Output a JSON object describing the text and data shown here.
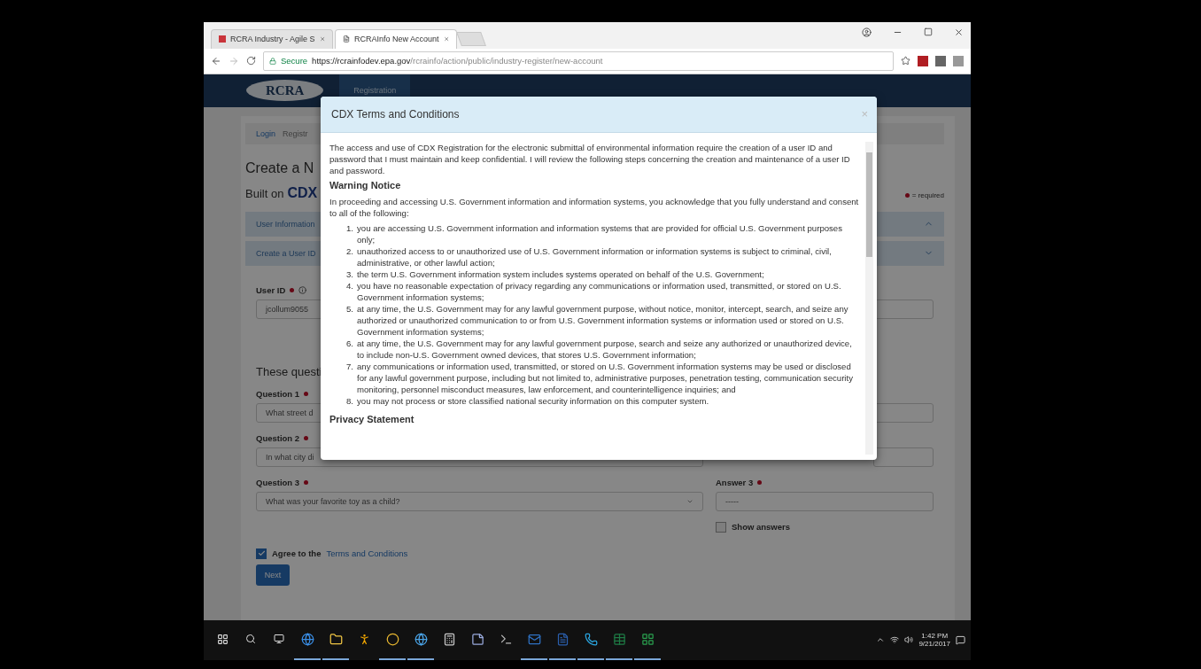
{
  "browser": {
    "tabs": [
      {
        "title": "RCRA Industry - Agile S",
        "selected": false,
        "kind": "site"
      },
      {
        "title": "RCRAInfo New Account",
        "selected": true,
        "kind": "page"
      }
    ],
    "security": "Secure",
    "url_host": "https://rcrainfodev.epa.gov",
    "url_path": "/rcrainfo/action/public/industry-register/new-account"
  },
  "site": {
    "logo": "RCRA",
    "nav_tab": "Registration"
  },
  "breadcrumb": [
    "Login",
    "Registr"
  ],
  "title": "Create a N",
  "subtitle_prefix": "Built on",
  "subtitle_brand": "CDX",
  "required_note": "= required",
  "sections": [
    {
      "label": "User Information",
      "expanded": false
    },
    {
      "label": "Create a User ID",
      "expanded": true
    }
  ],
  "user_id": {
    "label": "User ID",
    "value": "jcollum9055"
  },
  "questions_heading": "These questi",
  "questions": [
    {
      "label": "Question 1",
      "value": "What street d"
    },
    {
      "label": "Question 2",
      "value": "In what city di"
    },
    {
      "label": "Question 3",
      "value": "What was your favorite toy as a child?"
    }
  ],
  "answer": {
    "label": "Answer 3",
    "value": "-----"
  },
  "show_answers": {
    "label": "Show answers",
    "checked": false
  },
  "agree": {
    "prefix": "Agree to the",
    "link": "Terms and Conditions",
    "checked": true
  },
  "next_button": "Next",
  "modal": {
    "title": "CDX Terms and Conditions",
    "close": "×",
    "intro": "The access and use of CDX Registration for the electronic submittal of environmental information require the creation of a user ID and password that I must maintain and keep confidential. I will review the following steps concerning the creation and maintenance of a user ID and password.",
    "warning_heading": "Warning Notice",
    "warning_intro": "In proceeding and accessing U.S. Government information and information systems, you acknowledge that you fully understand and consent to all of the following:",
    "items": [
      {
        "number": "1.",
        "text": "you are accessing U.S. Government information and information systems that are provided for official U.S. Government purposes only;"
      },
      {
        "number": "2.",
        "text": "unauthorized access to or unauthorized use of U.S. Government information or information systems is subject to criminal, civil, administrative, or other lawful action;"
      },
      {
        "number": "3.",
        "text": "the term U.S. Government information system includes systems operated on behalf of the U.S. Government;"
      },
      {
        "number": "4.",
        "text": "you have no reasonable expectation of privacy regarding any communications or information used, transmitted, or stored on U.S. Government information systems;"
      },
      {
        "number": "5.",
        "text": "at any time, the U.S. Government may for any lawful government purpose, without notice, monitor, intercept, search, and seize any authorized or unauthorized communication to or from U.S. Government information systems or information used or stored on U.S. Government information systems;"
      },
      {
        "number": "6.",
        "text": "at any time, the U.S. Government may for any lawful government purpose, search and seize any authorized or unauthorized device, to include non-U.S. Government owned devices, that stores U.S. Government information;"
      },
      {
        "number": "7.",
        "text": "any communications or information used, transmitted, or stored on U.S. Government information systems may be used or disclosed for any lawful government purpose, including but not limited to, administrative purposes, penetration testing, communication security monitoring, personnel misconduct measures, law enforcement, and counterintelligence inquiries; and"
      },
      {
        "number": "8.",
        "text": "you may not process or store classified national security information on this computer system."
      }
    ],
    "privacy_heading": "Privacy Statement"
  },
  "taskbar": {
    "apps": [
      {
        "kind": "edge",
        "open": true
      },
      {
        "kind": "folder",
        "open": true
      },
      {
        "kind": "runner",
        "open": false
      },
      {
        "kind": "chrome",
        "open": true
      },
      {
        "kind": "ie",
        "open": true
      },
      {
        "kind": "calculator",
        "open": false
      },
      {
        "kind": "notes",
        "open": false
      },
      {
        "kind": "terminal",
        "open": false
      },
      {
        "kind": "outlook",
        "open": true
      },
      {
        "kind": "word",
        "open": true
      },
      {
        "kind": "skype",
        "open": true
      },
      {
        "kind": "excel",
        "open": true
      },
      {
        "kind": "sheet",
        "open": true
      }
    ],
    "time": "1:42 PM",
    "date": "9/21/2017"
  }
}
